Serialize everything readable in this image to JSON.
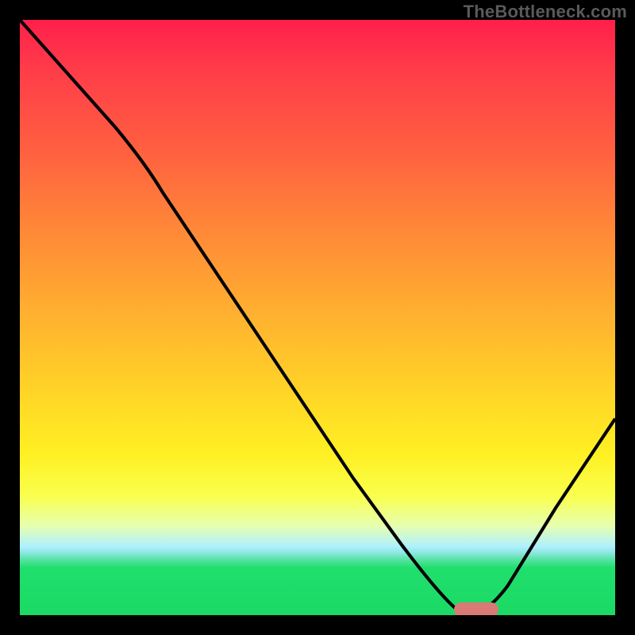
{
  "watermark": "TheBottleneck.com",
  "colors": {
    "curve_stroke": "#000000",
    "marker_fill": "#d97a76",
    "frame_bg": "#000000"
  },
  "chart_data": {
    "type": "line",
    "title": "",
    "xlabel": "",
    "ylabel": "",
    "xlim": [
      0,
      100
    ],
    "ylim": [
      0,
      100
    ],
    "grid": false,
    "legend": false,
    "series": [
      {
        "name": "bottleneck-curve",
        "x": [
          0,
          8,
          16,
          20,
          28,
          40,
          52,
          62,
          68,
          72,
          75,
          78,
          82,
          100
        ],
        "values": [
          100,
          91,
          82,
          77,
          66,
          48,
          31,
          17,
          8,
          3,
          1,
          1,
          5,
          33
        ]
      }
    ],
    "annotations": [
      {
        "name": "optimal-marker",
        "x": 76.5,
        "y": 0.8,
        "shape": "pill"
      }
    ]
  }
}
